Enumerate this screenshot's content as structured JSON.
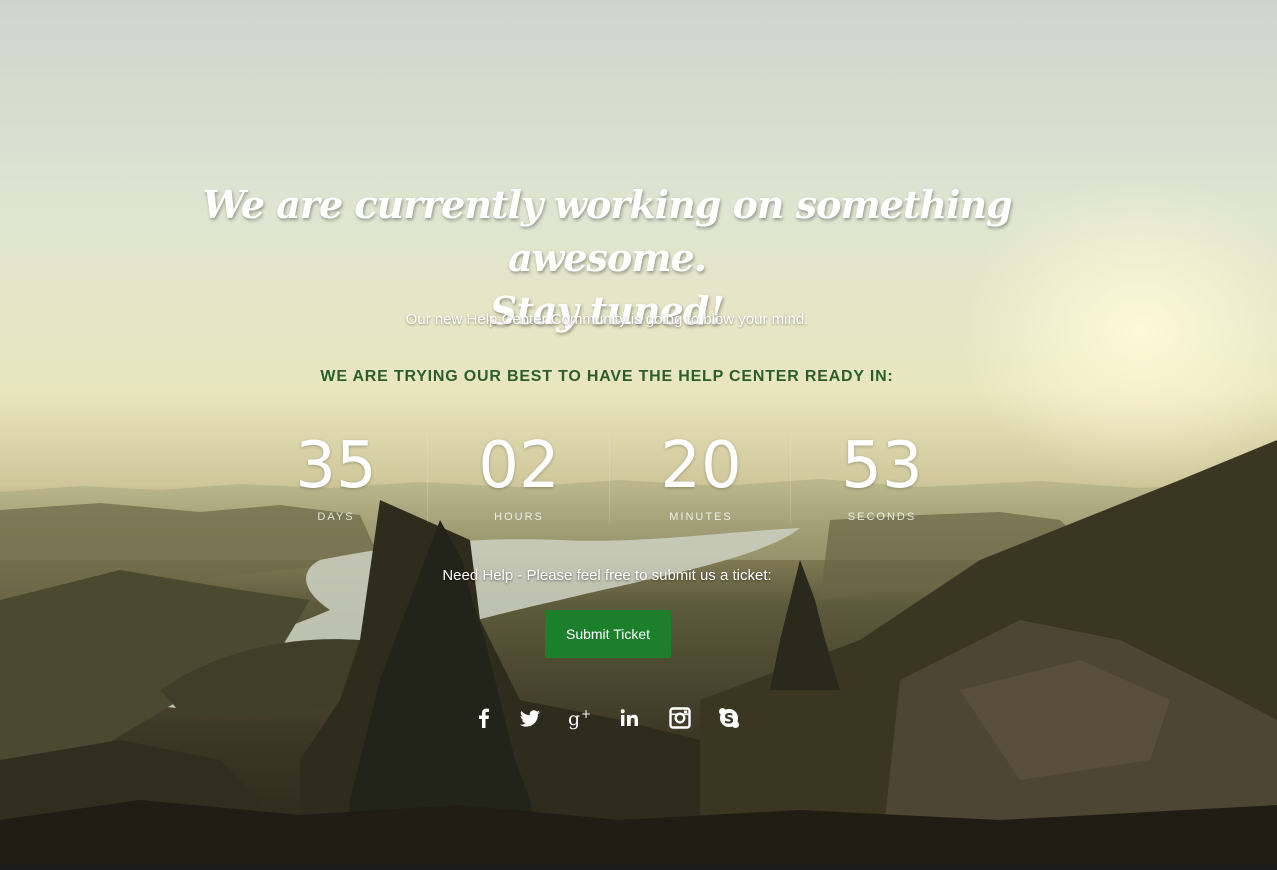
{
  "hero": {
    "title_line1": "We are currently working on something awesome.",
    "title_line2": "Stay tuned!",
    "subtitle": "Our new Help Center Community is going to blow your mind.",
    "ready_text": "WE ARE TRYING OUR BEST TO HAVE THE HELP CENTER READY IN:"
  },
  "countdown": [
    {
      "value": "35",
      "label": "DAYS"
    },
    {
      "value": "02",
      "label": "HOURS"
    },
    {
      "value": "20",
      "label": "MINUTES"
    },
    {
      "value": "53",
      "label": "SECONDS"
    }
  ],
  "help": {
    "text": "Need Help - Please feel free to submit us a ticket:",
    "button_label": "Submit Ticket"
  },
  "social": [
    "facebook-icon",
    "twitter-icon",
    "google-plus-icon",
    "linkedin-icon",
    "instagram-icon",
    "skype-icon"
  ],
  "colors": {
    "accent_green": "#1b7f2b",
    "heading_green": "#2b5e2b"
  }
}
